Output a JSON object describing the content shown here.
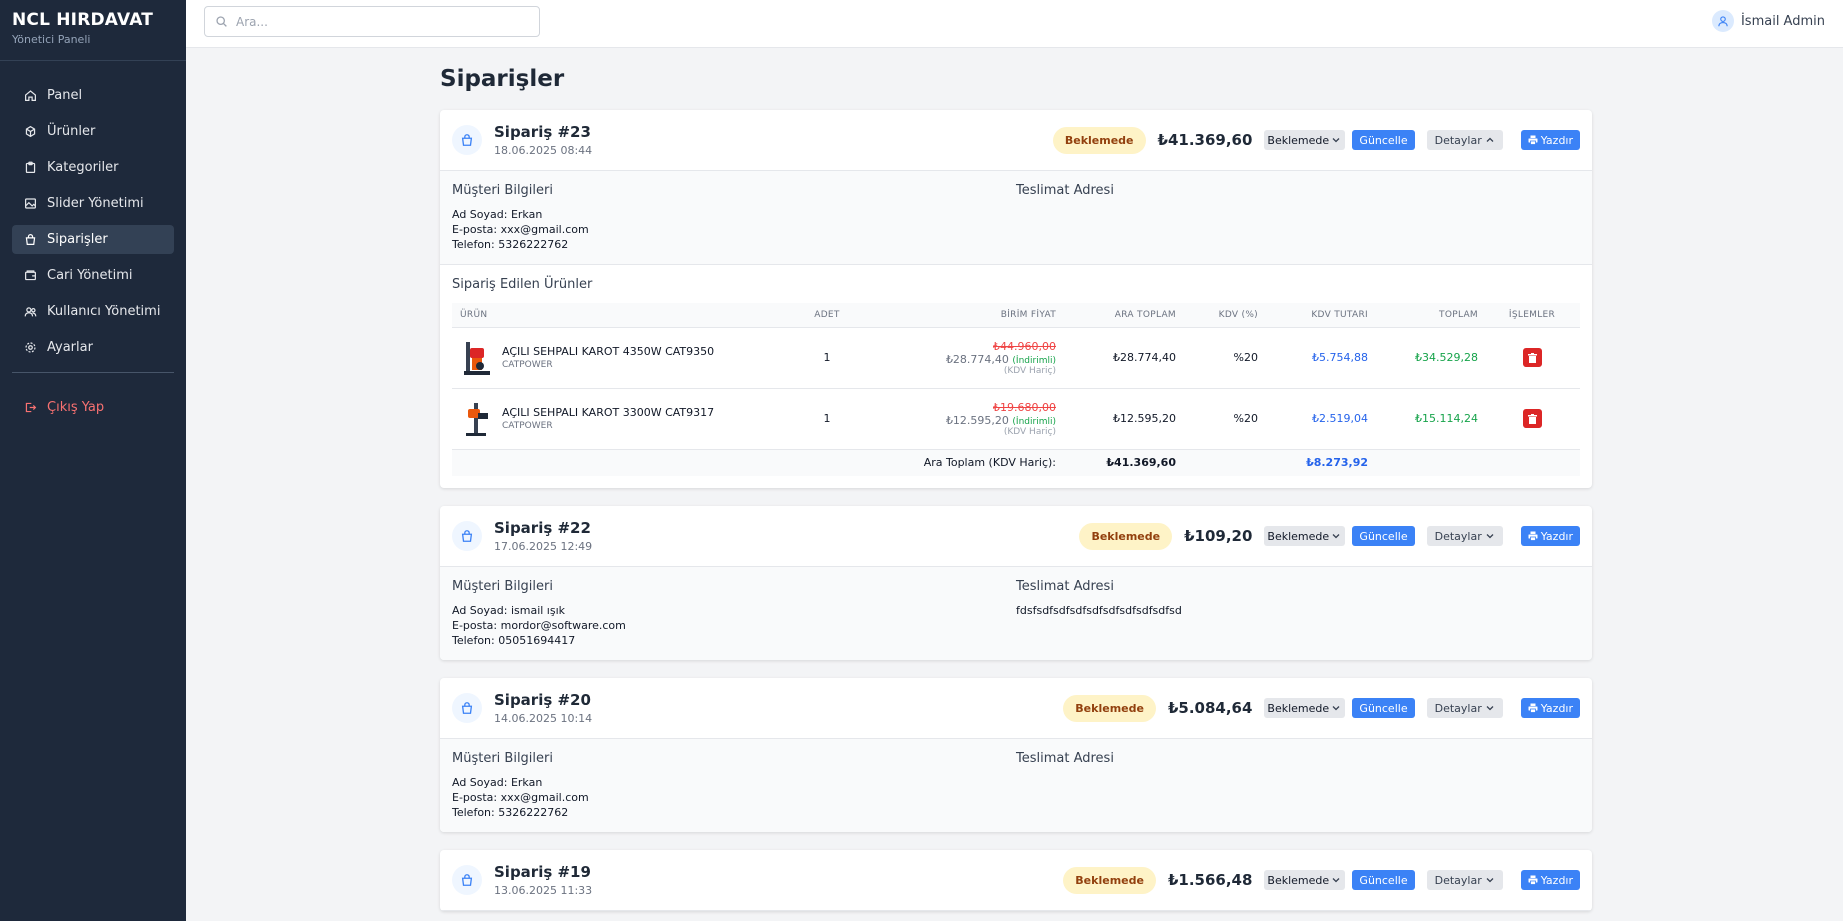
{
  "sidebar": {
    "brand": "NCL HIRDAVAT",
    "subtitle": "Yönetici Paneli",
    "items": [
      {
        "label": "Panel",
        "icon": "home-icon"
      },
      {
        "label": "Ürünler",
        "icon": "box-icon"
      },
      {
        "label": "Kategoriler",
        "icon": "clipboard-icon"
      },
      {
        "label": "Slider Yönetimi",
        "icon": "image-icon"
      },
      {
        "label": "Siparişler",
        "icon": "bag-icon"
      },
      {
        "label": "Cari Yönetimi",
        "icon": "wallet-icon"
      },
      {
        "label": "Kullanıcı Yönetimi",
        "icon": "users-icon"
      },
      {
        "label": "Ayarlar",
        "icon": "gear-icon"
      }
    ],
    "logout": "Çıkış Yap"
  },
  "topbar": {
    "search_placeholder": "Ara...",
    "user_name": "İsmail Admin"
  },
  "page": {
    "title": "Siparişler"
  },
  "labels": {
    "customer_info": "Müşteri Bilgileri",
    "delivery_address": "Teslimat Adresi",
    "ordered_products": "Sipariş Edilen Ürünler",
    "update": "Güncelle",
    "details": "Detaylar",
    "print": "Yazdır",
    "discounted": "(İndirimli)",
    "vat_excluded": "(KDV Hariç)",
    "subtotal_ex_vat": "Ara Toplam (KDV Hariç):"
  },
  "table_headers": [
    "ÜRÜN",
    "ADET",
    "BİRİM FİYAT",
    "ARA TOPLAM",
    "KDV (%)",
    "KDV TUTARI",
    "TOPLAM",
    "İŞLEMLER"
  ],
  "orders": [
    {
      "title": "Sipariş #23",
      "date": "18.06.2025 08:44",
      "status": "Beklemede",
      "total": "₺41.369,60",
      "select_value": "Beklemede",
      "expanded": true,
      "name": "Ad Soyad: Erkan",
      "email": "E-posta: xxx@gmail.com",
      "phone": "Telefon: 5326222762",
      "address": "",
      "products": [
        {
          "name": "AÇILI SEHPALI KAROT 4350W CAT9350",
          "brand": "CATPOWER",
          "qty": "1",
          "old_price": "₺44.960,00",
          "price": "₺28.774,40",
          "subtotal": "₺28.774,40",
          "vat_rate": "%20",
          "vat_amount": "₺5.754,88",
          "total": "₺34.529,28"
        },
        {
          "name": "AÇILI SEHPALI KAROT 3300W CAT9317",
          "brand": "CATPOWER",
          "qty": "1",
          "old_price": "₺19.680,00",
          "price": "₺12.595,20",
          "subtotal": "₺12.595,20",
          "vat_rate": "%20",
          "vat_amount": "₺2.519,04",
          "total": "₺15.114,24"
        }
      ],
      "sum_subtotal": "₺41.369,60",
      "sum_vat": "₺8.273,92"
    },
    {
      "title": "Sipariş #22",
      "date": "17.06.2025 12:49",
      "status": "Beklemede",
      "total": "₺109,20",
      "select_value": "Beklemede",
      "expanded": false,
      "name": "Ad Soyad: ismail ışık",
      "email": "E-posta: mordor@software.com",
      "phone": "Telefon: 05051694417",
      "address": "fdsfsdfsdfsdfsdfsdfsdfsdfsdfsd"
    },
    {
      "title": "Sipariş #20",
      "date": "14.06.2025 10:14",
      "status": "Beklemede",
      "total": "₺5.084,64",
      "select_value": "Beklemede",
      "expanded": false,
      "name": "Ad Soyad: Erkan",
      "email": "E-posta: xxx@gmail.com",
      "phone": "Telefon: 5326222762",
      "address": ""
    },
    {
      "title": "Sipariş #19",
      "date": "13.06.2025 11:33",
      "status": "Beklemede",
      "total": "₺1.566,48",
      "select_value": "Beklemede",
      "expanded": false
    }
  ]
}
